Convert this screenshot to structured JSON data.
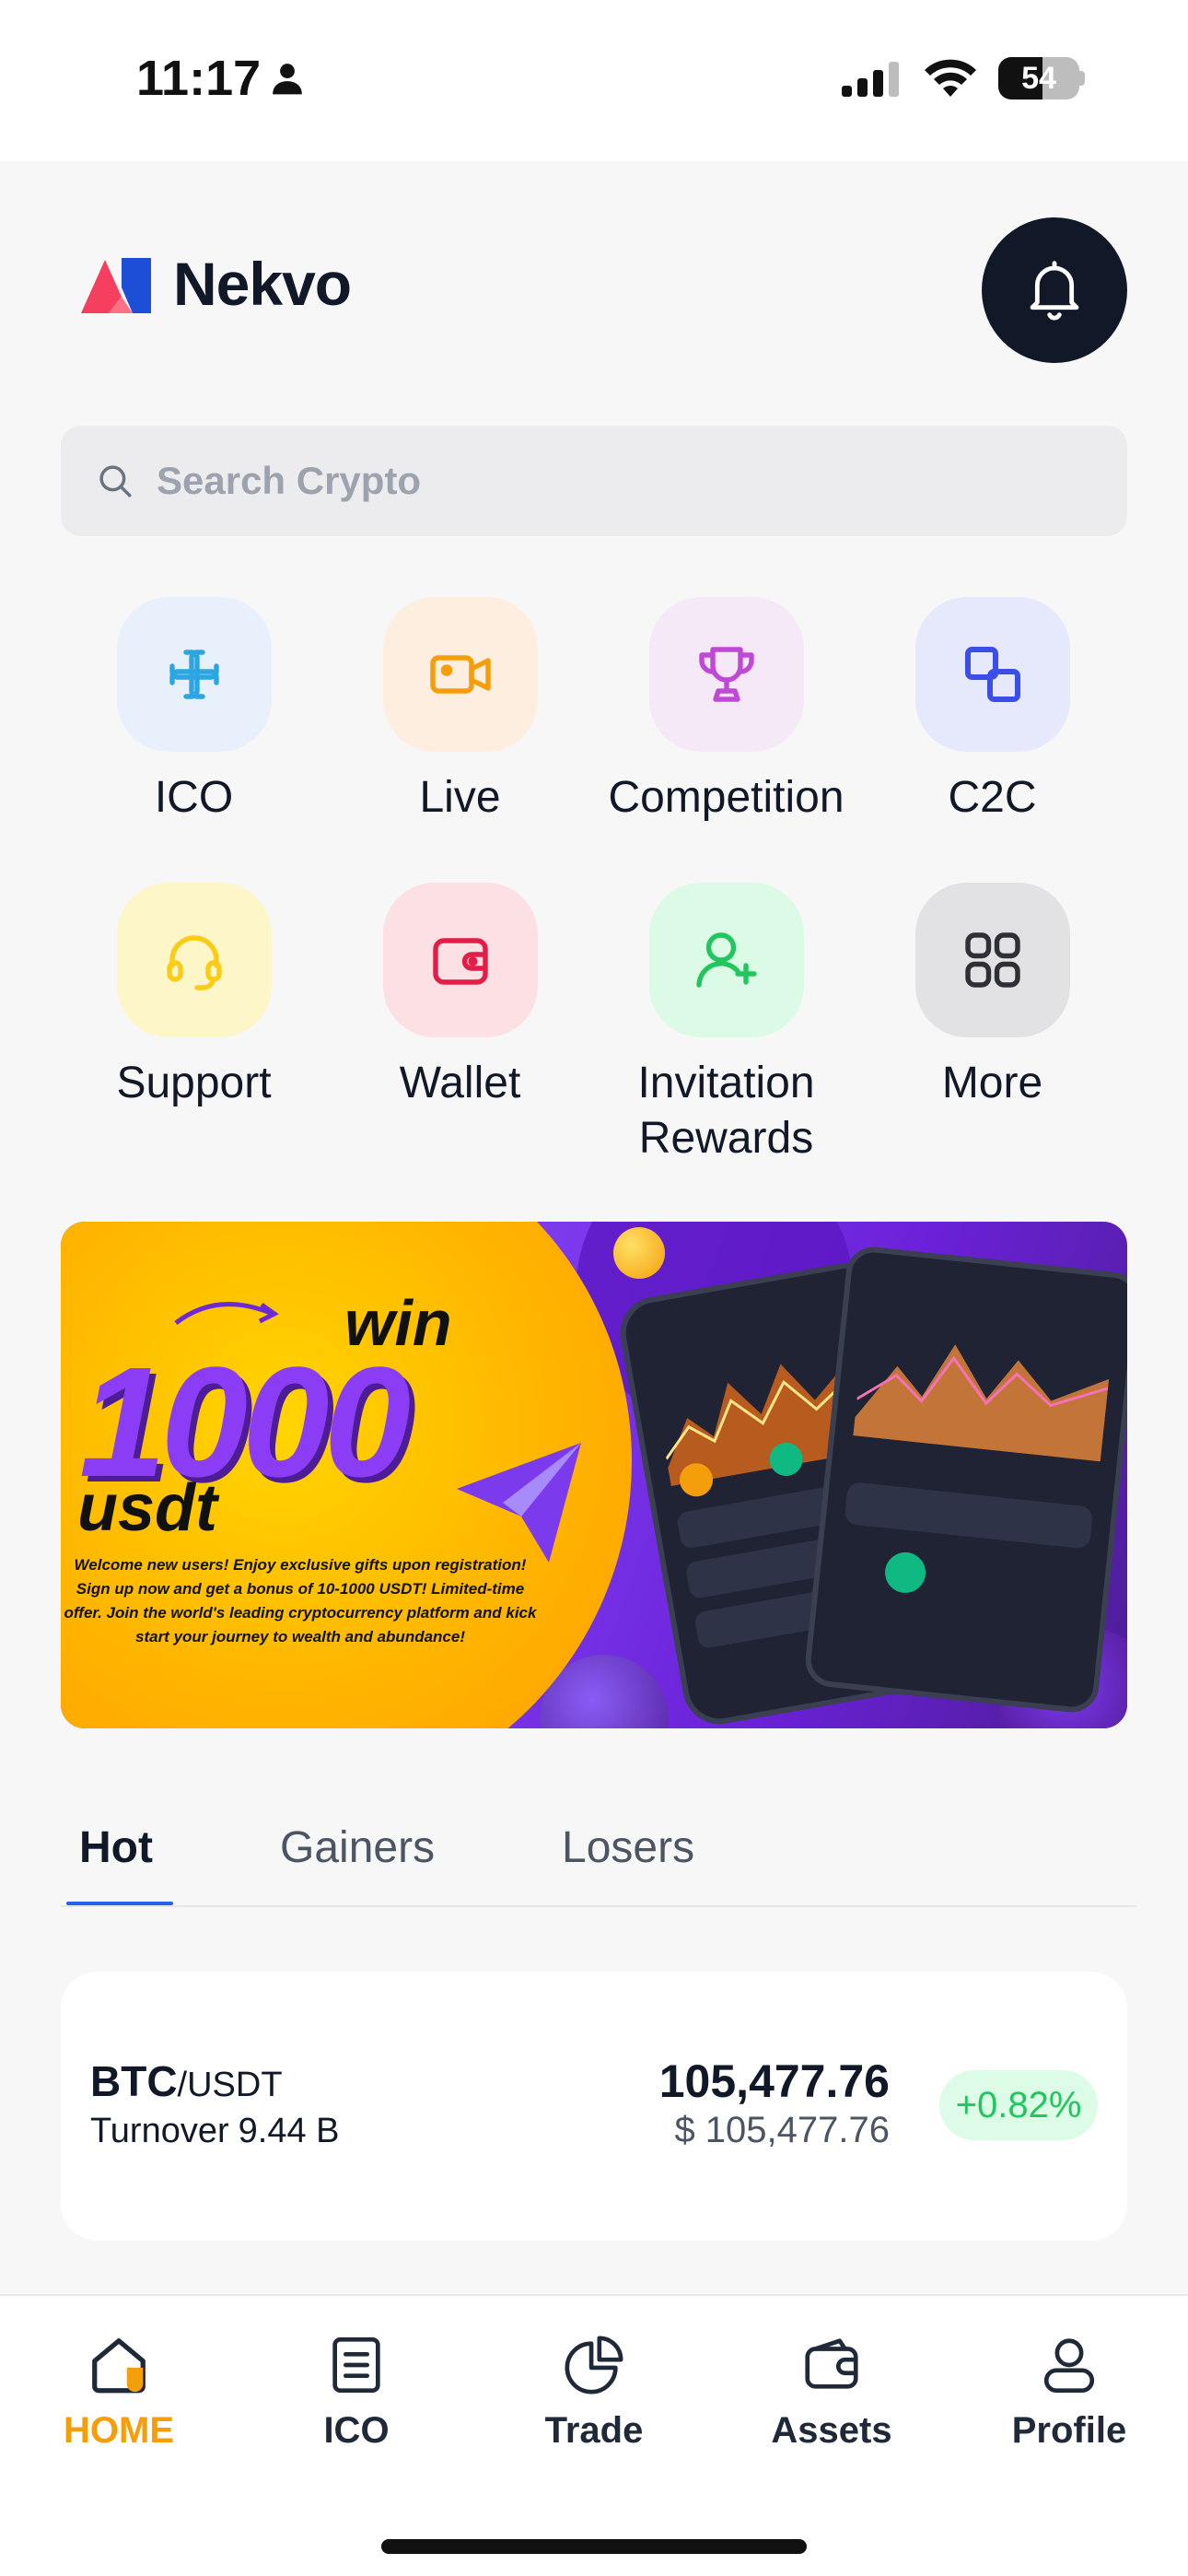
{
  "status_bar": {
    "time": "11:17",
    "battery": "54"
  },
  "header": {
    "app_name": "Nekvo"
  },
  "search": {
    "placeholder": "Search Crypto"
  },
  "quick_actions": [
    {
      "label": "ICO",
      "icon": "ico-link-icon",
      "bg": "#e8f1fb",
      "color": "#2ba6e1"
    },
    {
      "label": "Live",
      "icon": "video-camera-icon",
      "bg": "#fdeee0",
      "color": "#f59e0b"
    },
    {
      "label": "Competition",
      "icon": "trophy-icon",
      "bg": "#f5e8f7",
      "color": "#c048d6"
    },
    {
      "label": "C2C",
      "icon": "exchange-squares-icon",
      "bg": "#e6e8fb",
      "color": "#3b4ee8"
    },
    {
      "label": "Support",
      "icon": "headset-icon",
      "bg": "#fdf6c8",
      "color": "#facc15"
    },
    {
      "label": "Wallet",
      "icon": "wallet-icon",
      "bg": "#fde0e3",
      "color": "#e11d48"
    },
    {
      "label": "Invitation\nRewards",
      "label_line1": "Invitation",
      "label_line2": "Rewards",
      "icon": "add-user-icon",
      "bg": "#dcfbe6",
      "color": "#22c55e"
    },
    {
      "label": "More",
      "icon": "grid-icon",
      "bg": "#e2e2e4",
      "color": "#2f2f36"
    }
  ],
  "banner": {
    "win": "win",
    "amount": "1000",
    "currency": "usdt",
    "description": "Welcome new users! Enjoy exclusive gifts upon registration! Sign up now and get a bonus of 10-1000 USDT! Limited-time offer. Join the world's leading cryptocurrency platform and kick start your journey to wealth and abundance!"
  },
  "market_tabs": [
    {
      "label": "Hot",
      "active": true
    },
    {
      "label": "Gainers",
      "active": false
    },
    {
      "label": "Losers",
      "active": false
    }
  ],
  "tickers": [
    {
      "base": "BTC",
      "quote": "/USDT",
      "turnover_label": "Turnover",
      "turnover_value": "9.44 B",
      "price": "105,477.76",
      "price_usd": "$ 105,477.76",
      "change": "+0.82%"
    }
  ],
  "bottom_nav": [
    {
      "label": "HOME",
      "icon": "home-icon",
      "active": true
    },
    {
      "label": "ICO",
      "icon": "document-icon",
      "active": false
    },
    {
      "label": "Trade",
      "icon": "pie-chart-icon",
      "active": false
    },
    {
      "label": "Assets",
      "icon": "wallet-icon",
      "active": false
    },
    {
      "label": "Profile",
      "icon": "user-icon",
      "active": false
    }
  ],
  "colors": {
    "accent_active": "#f59e0b",
    "tab_underline": "#2563eb",
    "positive": "#22c55e"
  }
}
